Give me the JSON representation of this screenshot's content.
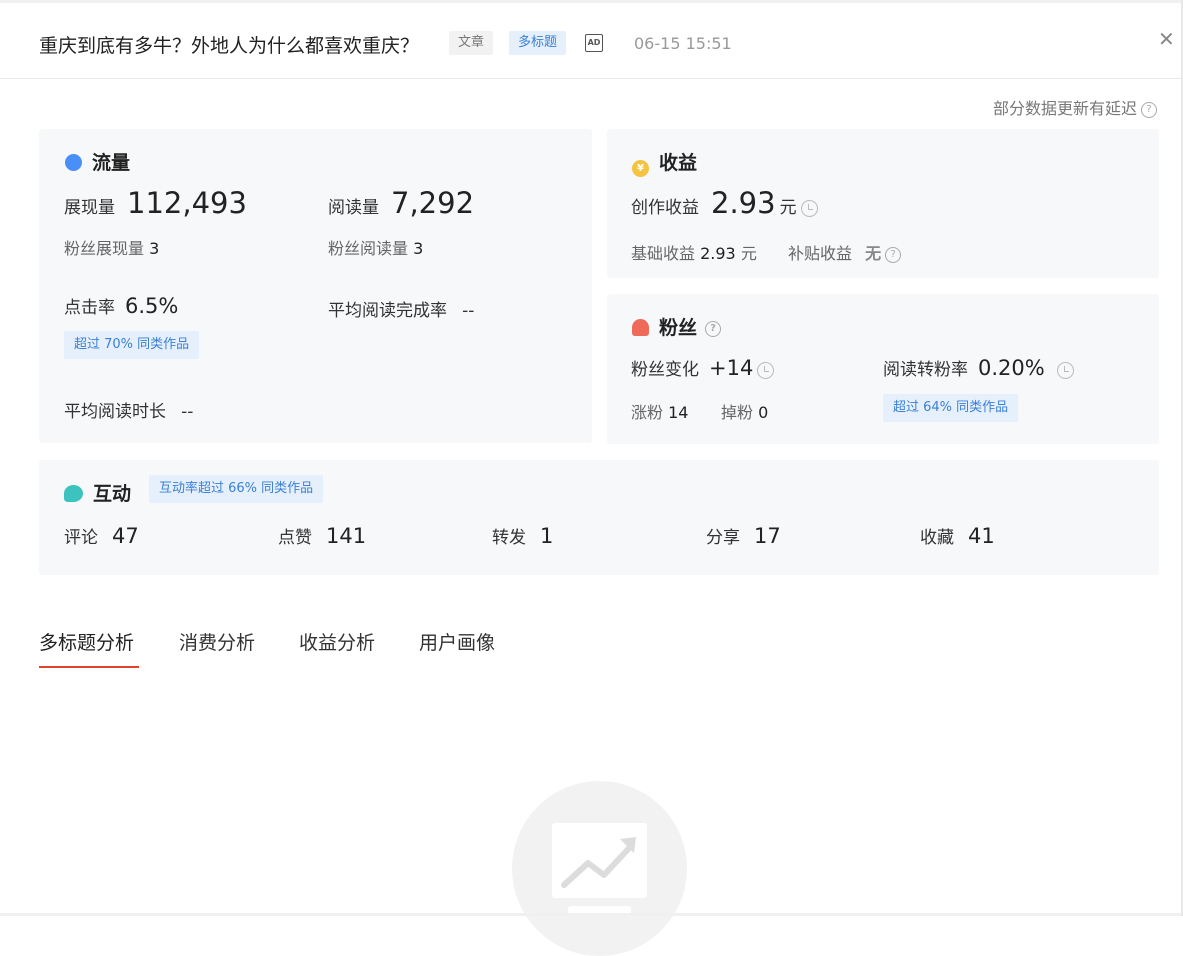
{
  "header": {
    "title": "重庆到底有多牛？外地人为什么都喜欢重庆？",
    "tag_type": "文章",
    "tag_multi": "多标题",
    "ad_icon": "AD",
    "time": "06-15 15:51",
    "close": "✕"
  },
  "delay_note": "部分数据更新有延迟",
  "help_glyph": "?",
  "traffic": {
    "title": "流量",
    "impressions_label": "展现量",
    "impressions_value": "112,493",
    "reads_label": "阅读量",
    "reads_value": "7,292",
    "fan_impressions_label": "粉丝展现量",
    "fan_impressions_value": "3",
    "fan_reads_label": "粉丝阅读量",
    "fan_reads_value": "3",
    "ctr_label": "点击率",
    "ctr_value": "6.5%",
    "ctr_badge": "超过 70% 同类作品",
    "completion_label": "平均阅读完成率",
    "completion_value": "--",
    "duration_label": "平均阅读时长",
    "duration_value": "--"
  },
  "income": {
    "title": "收益",
    "creation_label": "创作收益",
    "creation_value": "2.93",
    "currency": "元",
    "base_label": "基础收益",
    "base_value": "2.93",
    "base_unit": "元",
    "subsidy_label": "补贴收益",
    "subsidy_value": "无"
  },
  "fans": {
    "title": "粉丝",
    "change_label": "粉丝变化",
    "change_value": "+14",
    "gain_label": "涨粉",
    "gain_value": "14",
    "loss_label": "掉粉",
    "loss_value": "0",
    "conv_label": "阅读转粉率",
    "conv_value": "0.20%",
    "conv_badge": "超过 64% 同类作品"
  },
  "interaction": {
    "title": "互动",
    "badge": "互动率超过 66% 同类作品",
    "items": [
      {
        "label": "评论",
        "value": "47"
      },
      {
        "label": "点赞",
        "value": "141"
      },
      {
        "label": "转发",
        "value": "1"
      },
      {
        "label": "分享",
        "value": "17"
      },
      {
        "label": "收藏",
        "value": "41"
      }
    ]
  },
  "tabs": [
    {
      "label": "多标题分析"
    },
    {
      "label": "消费分析"
    },
    {
      "label": "收益分析"
    },
    {
      "label": "用户画像"
    }
  ],
  "colors": {
    "accent_red": "#e0452c",
    "badge_blue": "#3a7fd5",
    "traffic_icon": "#4a8ff7",
    "income_icon": "#f5c342",
    "fans_icon": "#f06a5a",
    "interaction_icon": "#3cc3c0"
  }
}
